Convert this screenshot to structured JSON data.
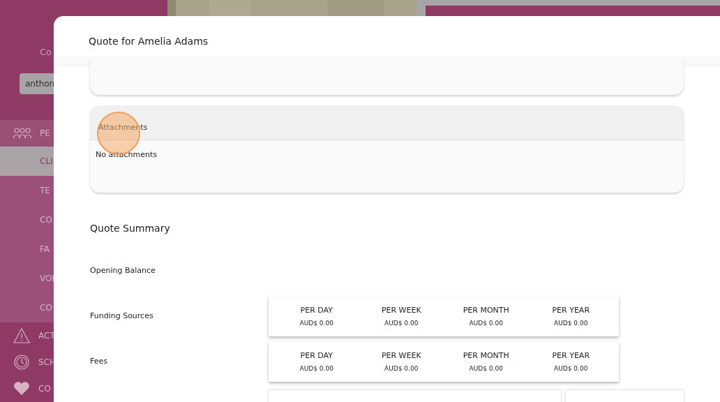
{
  "background": {
    "subtitle": "Co",
    "search": {
      "value": "anthon"
    },
    "nav": [
      {
        "label": "PE",
        "kind": "section",
        "selected": false
      },
      {
        "label": "CLI",
        "kind": "sub",
        "selected": true
      },
      {
        "label": "TE",
        "kind": "sub",
        "selected": false
      },
      {
        "label": "CO",
        "kind": "sub",
        "selected": false
      },
      {
        "label": "FA",
        "kind": "sub",
        "selected": false
      },
      {
        "label": "VOI",
        "kind": "sub",
        "selected": false
      },
      {
        "label": "CO",
        "kind": "sub",
        "selected": false
      },
      {
        "label": "ACT",
        "kind": "section",
        "selected": false
      },
      {
        "label": "SCH",
        "kind": "section",
        "selected": false
      },
      {
        "label": "CO",
        "kind": "section",
        "selected": false
      }
    ]
  },
  "modal": {
    "title": "Quote for Amelia Adams",
    "attachments": {
      "title": "Attachments",
      "empty_text": "No attachments"
    },
    "summary": {
      "title": "Quote Summary",
      "rows": [
        {
          "label": "Opening Balance"
        },
        {
          "label": "Funding Sources",
          "periods": [
            {
              "label": "PER DAY",
              "value": "AUD$ 0.00"
            },
            {
              "label": "PER WEEK",
              "value": "AUD$ 0.00"
            },
            {
              "label": "PER MONTH",
              "value": "AUD$ 0.00"
            },
            {
              "label": "PER YEAR",
              "value": "AUD$ 0.00"
            }
          ]
        },
        {
          "label": "Fees",
          "periods": [
            {
              "label": "PER DAY",
              "value": "AUD$ 0.00"
            },
            {
              "label": "PER WEEK",
              "value": "AUD$ 0.00"
            },
            {
              "label": "PER MONTH",
              "value": "AUD$ 0.00"
            },
            {
              "label": "PER YEAR",
              "value": "AUD$ 0.00"
            }
          ]
        }
      ]
    }
  }
}
